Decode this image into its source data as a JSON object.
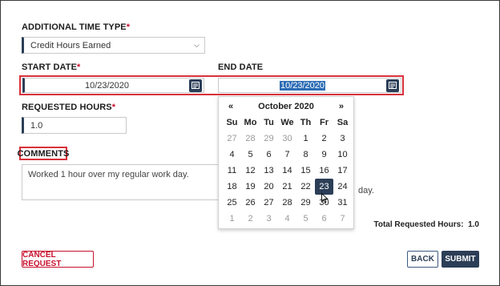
{
  "time_type": {
    "label": "ADDITIONAL TIME TYPE",
    "required_mark": "*",
    "value": "Credit Hours Earned"
  },
  "start_date": {
    "label": "START DATE",
    "required_mark": "*",
    "value": "10/23/2020"
  },
  "end_date": {
    "label": "END DATE",
    "value": "10/23/2020"
  },
  "requested_hours": {
    "label": "REQUESTED HOURS",
    "required_mark": "*",
    "value": "1.0"
  },
  "comments": {
    "label": "COMMENTS",
    "value": "Worked 1 hour over my regular work day.",
    "overflow_fragment": "day."
  },
  "calendar": {
    "prev": "«",
    "next": "»",
    "month_title": "October 2020",
    "weekdays": [
      "Su",
      "Mo",
      "Tu",
      "We",
      "Th",
      "Fr",
      "Sa"
    ],
    "weeks": [
      [
        "27",
        "28",
        "29",
        "30",
        "1",
        "2",
        "3"
      ],
      [
        "4",
        "5",
        "6",
        "7",
        "8",
        "9",
        "10"
      ],
      [
        "11",
        "12",
        "13",
        "14",
        "15",
        "16",
        "17"
      ],
      [
        "18",
        "19",
        "20",
        "21",
        "22",
        "23",
        "24"
      ],
      [
        "25",
        "26",
        "27",
        "28",
        "29",
        "30",
        "31"
      ],
      [
        "1",
        "2",
        "3",
        "4",
        "5",
        "6",
        "7"
      ]
    ],
    "selected_day": "23"
  },
  "total": {
    "label": "Total Requested Hours:",
    "value": "1.0"
  },
  "buttons": {
    "cancel": "CANCEL REQUEST",
    "back": "BACK",
    "submit": "SUBMIT"
  },
  "colors": {
    "primary": "#2c3e57",
    "danger": "#c8102e",
    "highlight_box": "#d9313a",
    "selection": "#2d6db5"
  }
}
